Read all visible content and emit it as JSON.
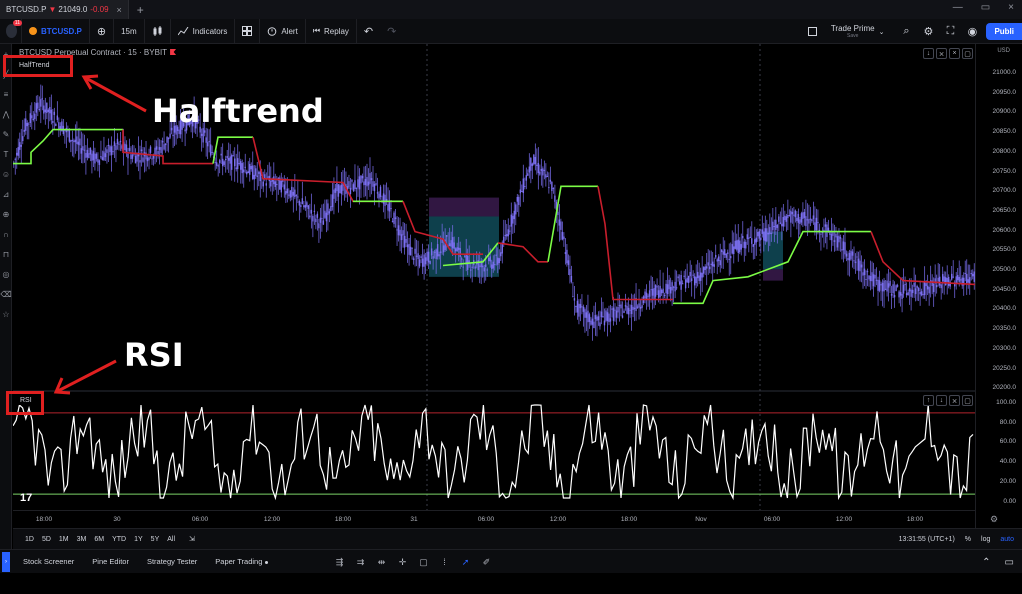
{
  "browser": {
    "tab_symbol": "BTCUSD.P",
    "tab_arrow": "▼",
    "tab_price": "21049.0",
    "tab_change": "-0.09",
    "tab_close": "×",
    "new_tab": "+",
    "window_controls": [
      "—",
      "▭",
      "×"
    ]
  },
  "toolbar": {
    "notification_count": "11",
    "symbol": "BTCUSD.P",
    "add_symbol": "⊕",
    "interval": "15m",
    "chart_type_icon": "candles-icon",
    "indicators_label": "Indicators",
    "layouts_icon": "grid-icon",
    "alert_label": "Alert",
    "replay_label": "Replay",
    "undo": "↶",
    "redo": "↷",
    "trade_prime": "Trade Prime",
    "trade_prime_sub": "Save",
    "publish_label": "Publi"
  },
  "chart": {
    "title": "BTCUSD Perpetual Contract · 15 · BYBIT",
    "halftrend_label": "HalfTrend",
    "rsi_label": "RSI",
    "currency": "USD",
    "price_ticks": [
      "21000.0",
      "20950.0",
      "20900.0",
      "20850.0",
      "20800.0",
      "20750.0",
      "20700.0",
      "20650.0",
      "20600.0",
      "20550.0",
      "20500.0",
      "20450.0",
      "20400.0",
      "20350.0",
      "20300.0",
      "20250.0",
      "20200.0"
    ],
    "rsi_ticks": [
      "100.00",
      "80.00",
      "60.00",
      "40.00",
      "20.00",
      "0.00"
    ],
    "time_ticks": [
      "18:00",
      "30",
      "06:00",
      "12:00",
      "18:00",
      "31",
      "06:00",
      "12:00",
      "18:00",
      "Nov",
      "06:00",
      "12:00",
      "18:00"
    ],
    "colors": {
      "uptrend": "#7cfc46",
      "downtrend": "#c81e2c",
      "candle": "#7b6ff0",
      "rsi": "#ffffff",
      "rsi_upper": "#b2242e",
      "rsi_lower": "#7cd468",
      "zone_cyan": "#1f8fa8",
      "zone_purple": "#5a2a78"
    }
  },
  "annotations": {
    "halftrend": "Halftrend",
    "rsi": "RSI"
  },
  "range_bar": {
    "ranges": [
      "1D",
      "5D",
      "1M",
      "3M",
      "6M",
      "YTD",
      "1Y",
      "5Y",
      "All"
    ],
    "time": "13:31:55 (UTC+1)",
    "percent": "%",
    "log": "log",
    "auto": "auto"
  },
  "bottom_bar": {
    "tabs": [
      "Stock Screener",
      "Pine Editor",
      "Strategy Tester",
      "Paper Trading"
    ]
  }
}
